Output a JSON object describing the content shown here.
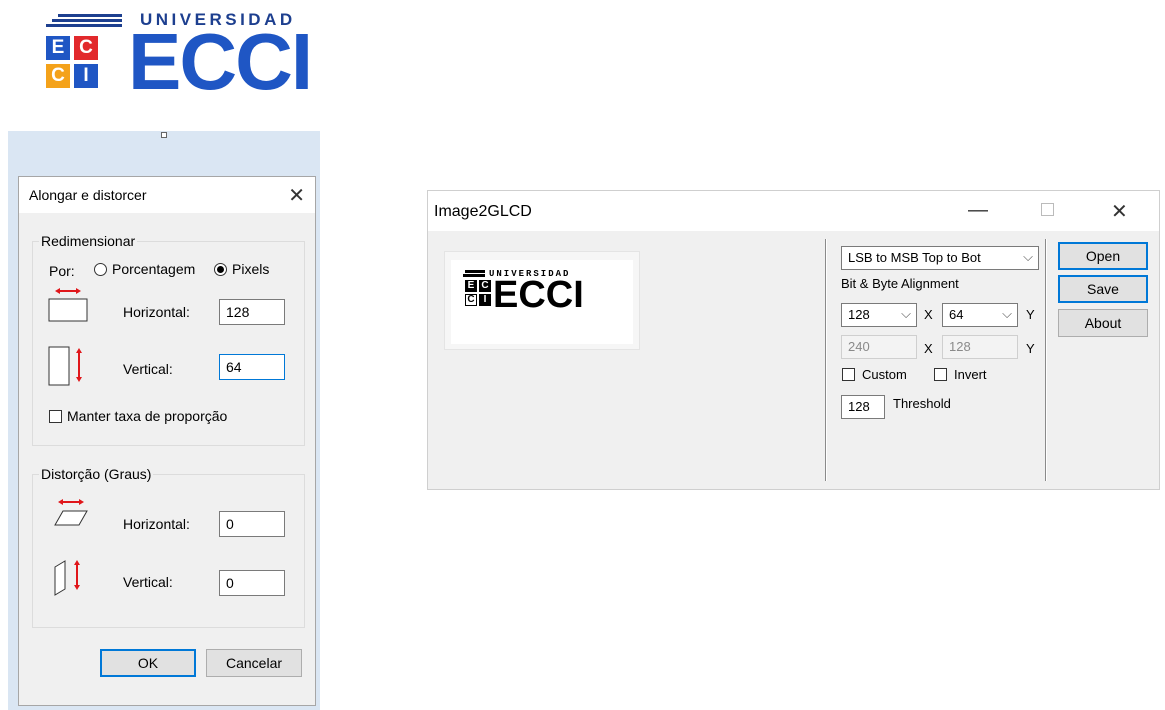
{
  "logo": {
    "word": "UNIVERSIDAD",
    "big": "ECCI",
    "tiles": [
      "E",
      "C",
      "C",
      "I"
    ],
    "tile_colors": [
      "#1f56c4",
      "#e2292c",
      "#f4a21a",
      "#1f56c4"
    ],
    "brand_color": "#1f56c4"
  },
  "dialog": {
    "title": "Alongar e distorcer",
    "close_icon": "close-icon",
    "resize_group": {
      "legend": "Redimensionar",
      "by_label": "Por:",
      "percent_option": "Porcentagem",
      "pixels_option": "Pixels",
      "selected": "Pixels",
      "horizontal_label": "Horizontal:",
      "horizontal_value": "128",
      "vertical_label": "Vertical:",
      "vertical_value": "64",
      "keep_ratio_label": "Manter taxa de proporção",
      "keep_ratio_checked": false
    },
    "skew_group": {
      "legend": "Distorção (Graus)",
      "horizontal_label": "Horizontal:",
      "horizontal_value": "0",
      "vertical_label": "Vertical:",
      "vertical_value": "0"
    },
    "ok_label": "OK",
    "cancel_label": "Cancelar"
  },
  "glcd": {
    "title": "Image2GLCD",
    "alignment_option": "LSB to MSB Top to Bot",
    "alignment_label": "Bit & Byte Alignment",
    "width_value": "128",
    "height_value": "64",
    "x_label": "X",
    "y_label": "Y",
    "orig_width": "240",
    "orig_height": "128",
    "custom_label": "Custom",
    "invert_label": "Invert",
    "threshold_value": "128",
    "threshold_label": "Threshold",
    "open_label": "Open",
    "save_label": "Save",
    "about_label": "About",
    "preview": {
      "word": "UNIVERSIDAD",
      "big": "ECCI",
      "tiles": [
        "E",
        "C",
        "C",
        "I"
      ]
    }
  }
}
